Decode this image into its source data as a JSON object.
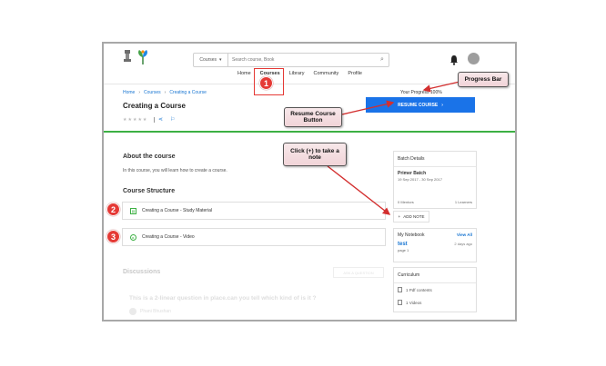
{
  "header": {
    "search_scope": "Courses",
    "search_placeholder": "Search course, Book",
    "nav": [
      "Home",
      "Courses",
      "Library",
      "Community",
      "Profile"
    ]
  },
  "breadcrumb": [
    "Home",
    "Courses",
    "Creating a Course"
  ],
  "course": {
    "title": "Creating a Course",
    "stars": "★★★★★",
    "progress_text": "Your Progress 100%",
    "resume_label": "RESUME COURSE",
    "about_title": "About the course",
    "about_text": "In this course, you will learn how to create a course.",
    "structure_title": "Course Structure",
    "lessons": [
      "Creating a Course - Study Material",
      "Creating a Course - Video"
    ]
  },
  "discussions": {
    "title": "Discussions",
    "ask_label": "ASK A QUESTION",
    "question": "This is a 2-linear question in place.can you tell which kind of is it ?",
    "author": "Phani Bhushan"
  },
  "batch": {
    "heading": "Batch Details",
    "name": "Primer Batch",
    "dates": "19 Sep 2017 - 30 Sep 2017",
    "mentors": "0 Mentors",
    "learners": "1 Learners"
  },
  "add_note_label": "ADD NOTE",
  "notebook": {
    "heading": "My Notebook",
    "view_all": "View All",
    "note_title": "test",
    "note_time": "2 days ago",
    "note_page": "page 1"
  },
  "curriculum": {
    "heading": "Curriculum",
    "items": [
      "1 Pdf contents",
      "1 Videos"
    ]
  },
  "annotations": {
    "progress_bar": "Progress Bar",
    "resume_callout": "Resume Course Button",
    "note_callout": "Click (+) to take a note",
    "badges": [
      "1",
      "2",
      "3"
    ]
  },
  "colors": {
    "accent": "#1a73e8",
    "progress_line": "#3cb043",
    "annotation": "#e53935"
  }
}
